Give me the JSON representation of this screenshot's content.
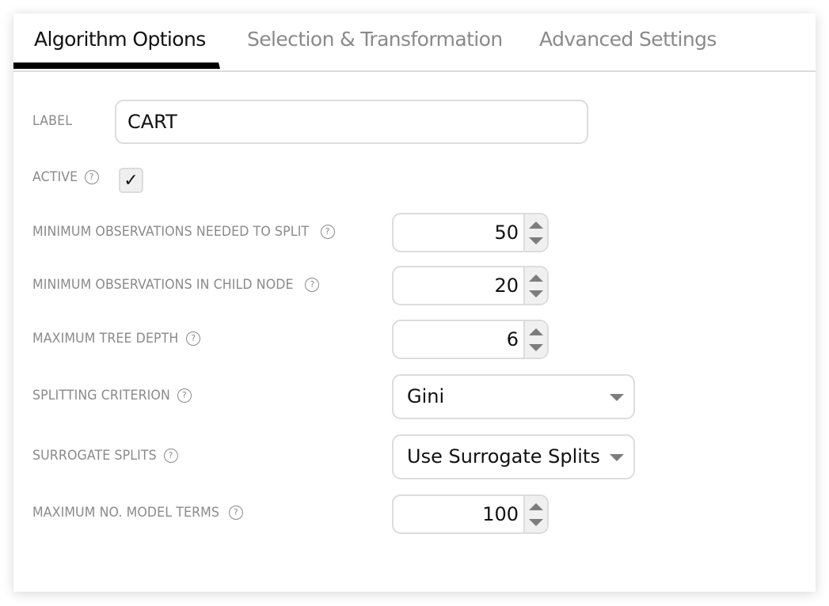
{
  "tabs": [
    {
      "label": "Algorithm Options",
      "active": true
    },
    {
      "label": "Selection & Transformation",
      "active": false
    },
    {
      "label": "Advanced Settings",
      "active": false
    }
  ],
  "form": {
    "label": {
      "caption": "LABEL",
      "value": "CART"
    },
    "active": {
      "caption": "ACTIVE",
      "checked": true,
      "check_glyph": "✓"
    },
    "help_glyph": "?",
    "min_obs_split": {
      "caption": "MINIMUM OBSERVATIONS NEEDED TO SPLIT",
      "value": "50"
    },
    "min_obs_child": {
      "caption": "MINIMUM OBSERVATIONS IN CHILD NODE",
      "value": "20"
    },
    "max_tree_depth": {
      "caption": "MAXIMUM TREE DEPTH",
      "value": "6"
    },
    "splitting_criterion": {
      "caption": "SPLITTING CRITERION",
      "value": "Gini"
    },
    "surrogate_splits": {
      "caption": "SURROGATE SPLITS",
      "value": "Use Surrogate Splits"
    },
    "max_model_terms": {
      "caption": "MAXIMUM NO. MODEL TERMS",
      "value": "100"
    }
  }
}
